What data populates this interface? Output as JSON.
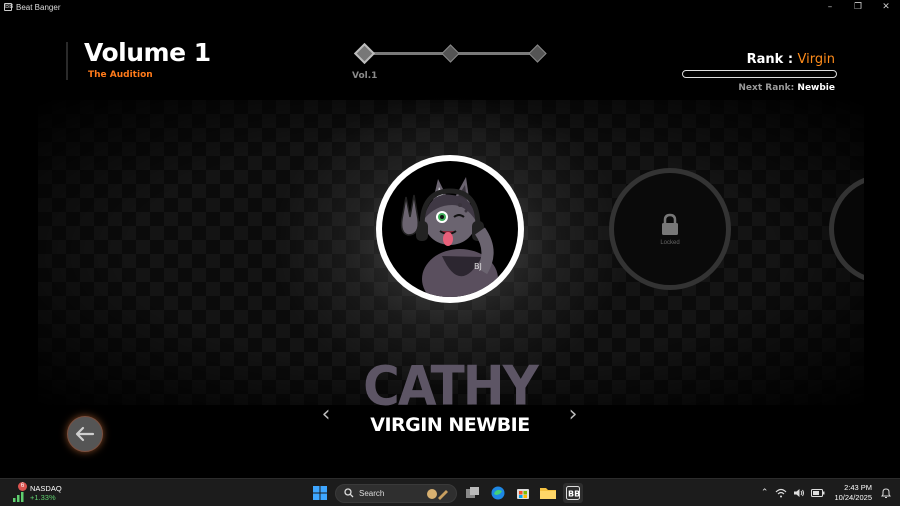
{
  "window": {
    "title": "Beat Banger",
    "icon_glyph": "BB",
    "minimize": "–",
    "maximize": "❐",
    "close": "✕"
  },
  "header": {
    "volume_title": "Volume 1",
    "volume_subtitle": "The Audition",
    "volume_progress_label": "Vol.1",
    "rank_label": "Rank : ",
    "rank_value": "Virgin",
    "next_rank_label": "Next Rank: ",
    "next_rank_value": "Newbie"
  },
  "character": {
    "name": "CATHY",
    "rank_line": "VIRGIN NEWBIE",
    "locked_text": "Locked"
  },
  "navigation": {
    "prev_arrow": "‹",
    "next_arrow": "›"
  },
  "taskbar": {
    "widget_badge": "6",
    "widget_name": "NASDAQ",
    "widget_change": "+1.33%",
    "search_label": "Search",
    "tray_chevron": "⌃",
    "time": "2:43 PM",
    "date": "10/24/2025"
  },
  "colors": {
    "accent_orange": "#ff7a1a",
    "rank_orange": "#ff8c1a",
    "name_gray": "#5d5565",
    "widget_green": "#5fcf6f"
  }
}
